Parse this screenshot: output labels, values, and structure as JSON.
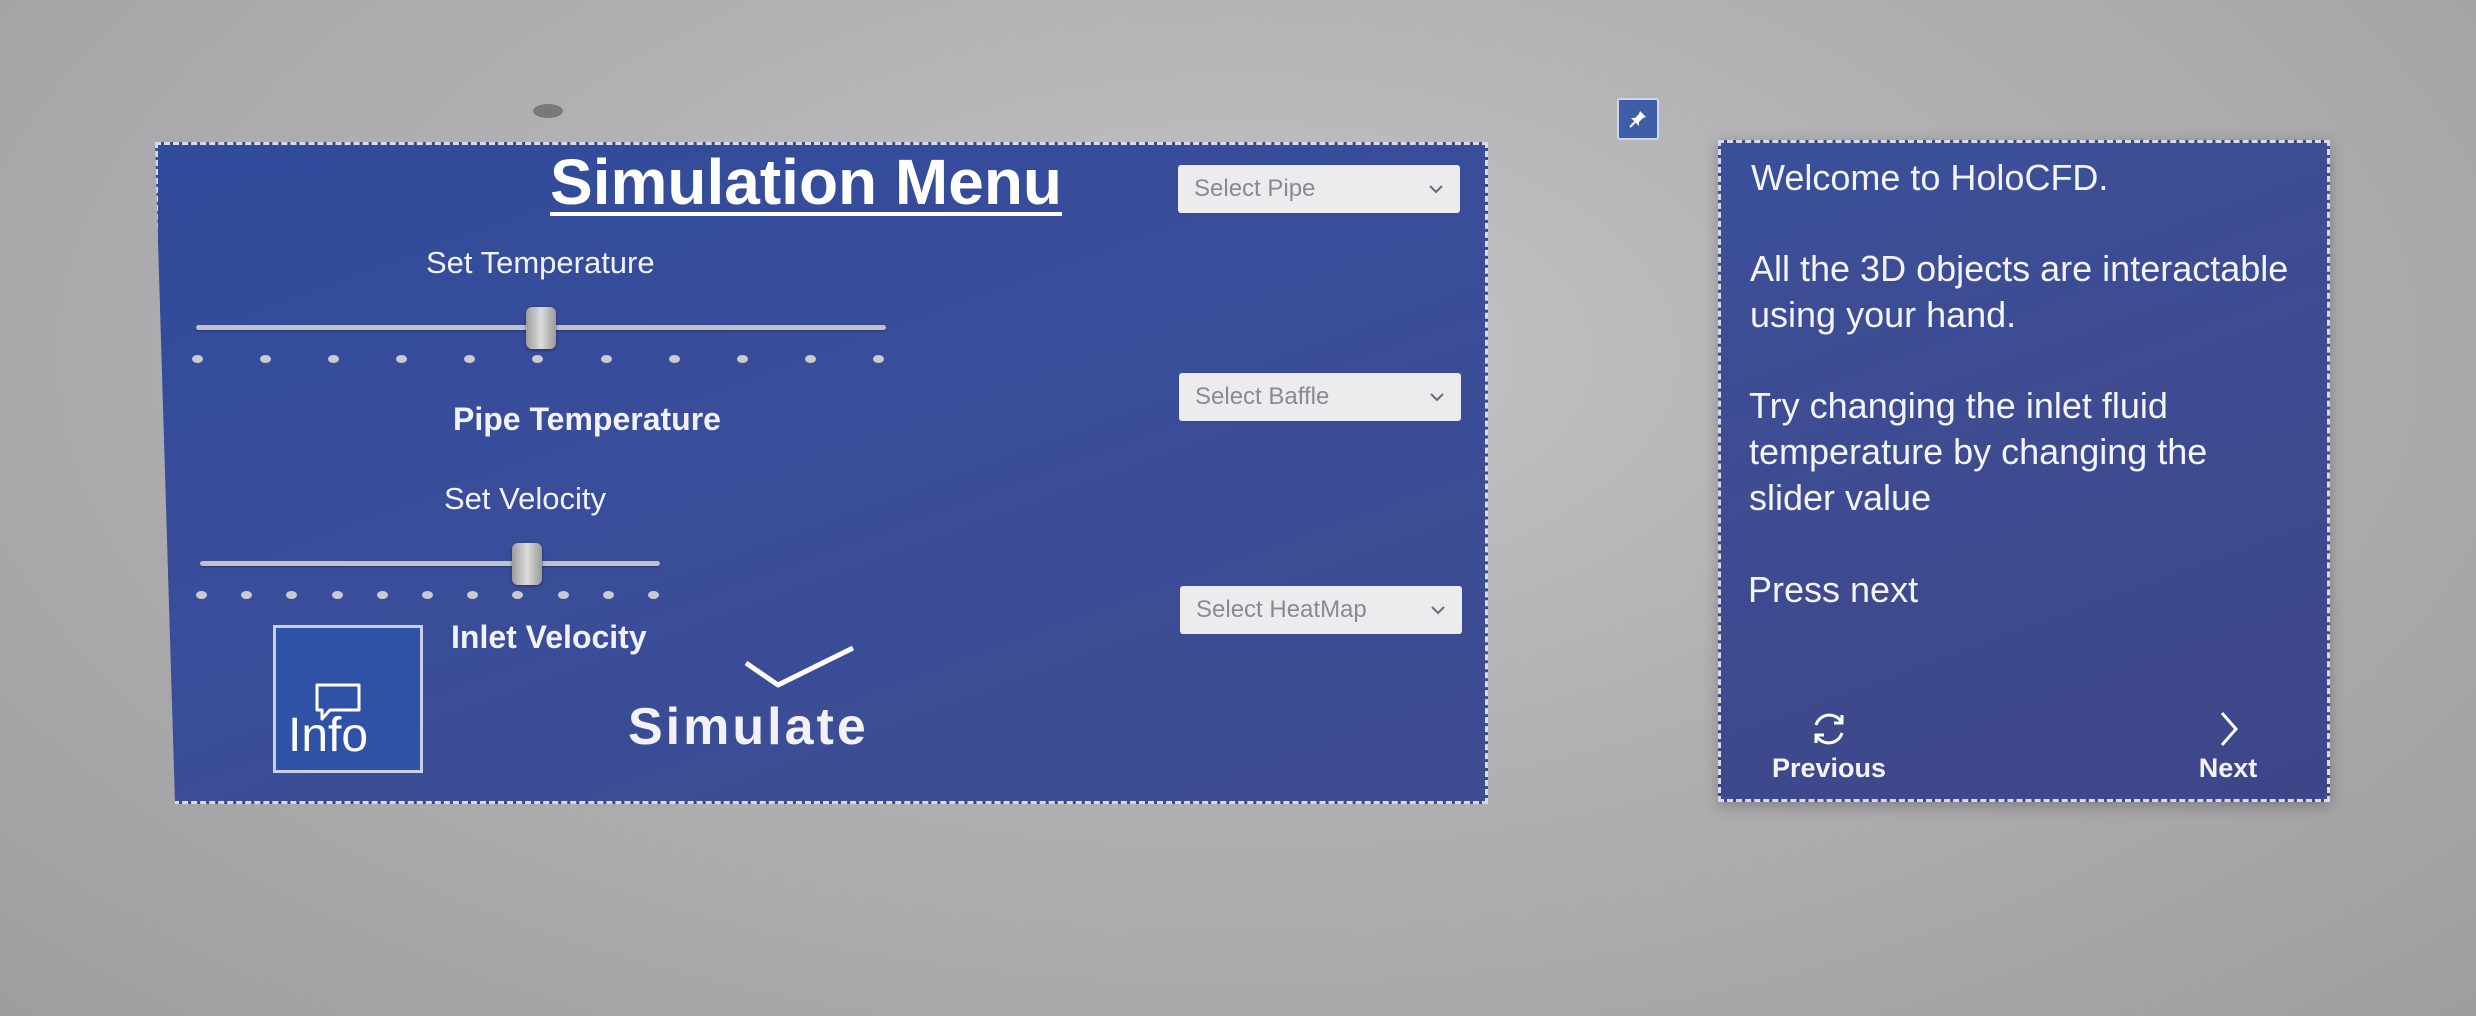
{
  "simulation_menu": {
    "title": "Simulation Menu",
    "temperature_slider": {
      "label": "Set Temperature",
      "value_label": "Pipe Temperature",
      "fraction": 0.5,
      "tick_count": 11
    },
    "velocity_slider": {
      "label": "Set Velocity",
      "value_label": "Inlet Velocity",
      "fraction": 0.71,
      "tick_count": 11
    },
    "dropdowns": {
      "pipe": "Select Pipe",
      "baffle": "Select Baffle",
      "heatmap": "Select HeatMap"
    },
    "info_button": {
      "label": "Info",
      "icon": "chat-bubble-icon"
    },
    "simulate_button": {
      "label": "Simulate",
      "icon": "checkmark-icon"
    }
  },
  "tutorial": {
    "line1": "Welcome to HoloCFD.",
    "paragraph2": "All the 3D objects are interactable using your hand.",
    "paragraph3": "Try changing the inlet fluid temperature by changing the slider value",
    "paragraph4": "Press next",
    "previous_label": "Previous",
    "next_label": "Next"
  },
  "pin_button": {
    "icon": "pin-icon"
  },
  "colors": {
    "panel": "#3a4d9a",
    "panel_border": "#d8dbe6",
    "dropdown_bg": "#ececef",
    "dropdown_text": "#8a8b90",
    "background": "#b3b3b5"
  }
}
